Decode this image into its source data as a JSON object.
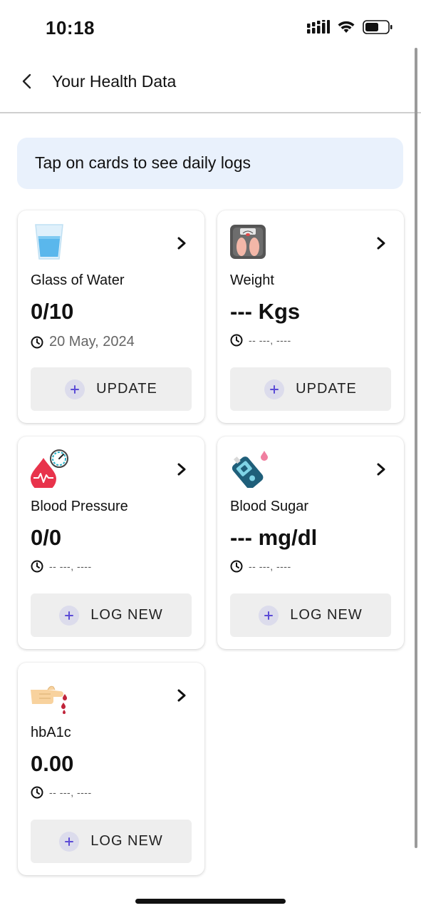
{
  "status_bar": {
    "time": "10:18"
  },
  "header": {
    "title": "Your Health Data",
    "back_icon": "chevron-left-icon"
  },
  "banner": {
    "text": "Tap on cards to see daily logs",
    "color": "#e9f1fc"
  },
  "cards": [
    {
      "label": "Glass of Water",
      "value": "0/10",
      "date": "20 May, 2024",
      "button": "UPDATE",
      "icon": "water-glass-icon"
    },
    {
      "label": "Weight",
      "value": "--- Kgs",
      "date": "-- ---, ----",
      "button": "UPDATE",
      "icon": "weighing-scale-icon"
    },
    {
      "label": "Blood Pressure",
      "value": "0/0",
      "date": "-- ---, ----",
      "button": "LOG NEW",
      "icon": "blood-pressure-icon"
    },
    {
      "label": "Blood Sugar",
      "value": "--- mg/dl",
      "date": "-- ---, ----",
      "button": "LOG NEW",
      "icon": "glucometer-icon"
    },
    {
      "label": "hbA1c",
      "value": "0.00",
      "date": "-- ---, ----",
      "button": "LOG NEW",
      "icon": "finger-blood-drop-icon"
    }
  ],
  "colors": {
    "accent_plus": "#5b4bd6",
    "button_bg": "#eeeeee"
  }
}
